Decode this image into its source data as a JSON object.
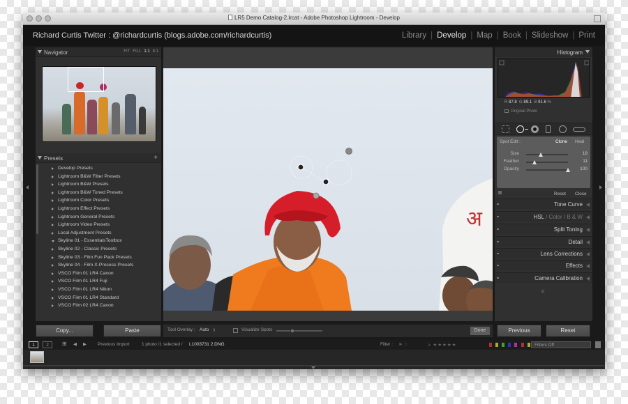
{
  "window": {
    "title": "LR5 Demo Catalog-2.lrcat - Adobe Photoshop Lightroom - Develop"
  },
  "identity_plate": "Richard Curtis Twitter : @richardcurtis (blogs.adobe.com/richardcurtis)",
  "modules": [
    {
      "label": "Library",
      "active": false
    },
    {
      "label": "Develop",
      "active": true
    },
    {
      "label": "Map",
      "active": false
    },
    {
      "label": "Book",
      "active": false
    },
    {
      "label": "Slideshow",
      "active": false
    },
    {
      "label": "Print",
      "active": false
    }
  ],
  "navigator": {
    "title": "Navigator",
    "options": [
      "FIT",
      "FILL",
      "1:1",
      "8:1"
    ]
  },
  "presets": {
    "title": "Presets",
    "add_label": "+",
    "items": [
      "Develop Presets",
      "Lightroom B&W Filter Presets",
      "Lightroom B&W Presets",
      "Lightroom B&W Toned Presets",
      "Lightroom Color Presets",
      "Lightroom Effect Presets",
      "Lightroom General Presets",
      "Lightroom Video Presets",
      "Local Adjustment Presets",
      "Skyline 01 - EssentialsToolbox",
      "Skyline 02 - Classic Presets",
      "Skyline 03 - Film Fun Pack Presets",
      "Skyline 04 - Film X-Process Presets",
      "VSCO Film 01 LR4 Canon",
      "VSCO Film 01 LR4 Fuji",
      "VSCO Film 01 LR4 Nikon",
      "VSCO Film 01 LR4 Standard",
      "VSCO Film 02 LR4 Canon"
    ],
    "open_index": 9
  },
  "left_buttons": {
    "copy": "Copy...",
    "paste": "Paste"
  },
  "toolbar": {
    "tool_overlay_label": "Tool Overlay :",
    "tool_overlay_value": "Auto",
    "visualize_label": "Visualize Spots",
    "done": "Done"
  },
  "histogram": {
    "title": "Histogram",
    "r_label": "R",
    "r_value": "87.8",
    "g_label": "G",
    "g_value": "89.1",
    "b_label": "B",
    "b_value": "91.6",
    "unit": "%",
    "original_photo": "Original Photo"
  },
  "spot_edit": {
    "label": "Spot Edit :",
    "clone": "Clone",
    "heal": "Heal",
    "size_label": "Size",
    "size_value": "18",
    "size": 0.35,
    "feather_label": "Feather",
    "feather_value": "11",
    "feather": 0.2,
    "opacity_label": "Opacity",
    "opacity_value": "100",
    "opacity": 1.0,
    "reset": "Reset",
    "close": "Close"
  },
  "panels": {
    "tone_curve": "Tone Curve",
    "hsl_a": "HSL",
    "hsl_b": "Color",
    "hsl_c": "B & W",
    "hsl_sep": "/",
    "split_toning": "Split Toning",
    "detail": "Detail",
    "lens_corrections": "Lens Corrections",
    "effects": "Effects",
    "camera_calibration": "Camera Calibration"
  },
  "right_buttons": {
    "previous": "Previous",
    "reset": "Reset"
  },
  "filmstrip": {
    "screen1": "1",
    "screen2": "2",
    "source": "Previous Import",
    "count": "1 photo /1 selected /",
    "filename": "L1003731 2.DNG",
    "filter_label": "Filter :",
    "filters_off": "Filters Off"
  },
  "photo_sign_text": "अ"
}
